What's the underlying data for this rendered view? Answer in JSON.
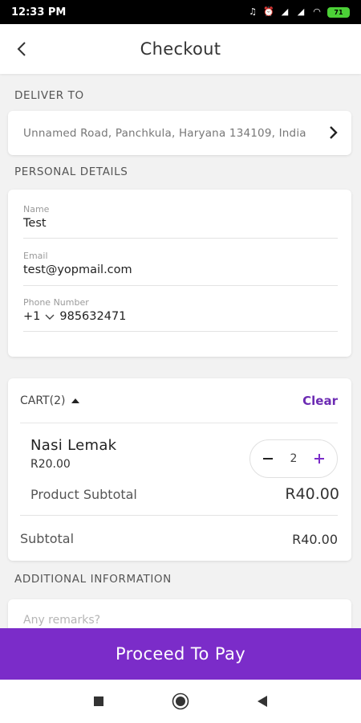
{
  "status_bar": {
    "time": "12:33 PM",
    "battery": "71"
  },
  "header": {
    "title": "Checkout"
  },
  "deliver_to": {
    "label": "DELIVER TO",
    "address": "Unnamed Road, Panchkula, Haryana 134109, India"
  },
  "personal_details": {
    "label": "PERSONAL DETAILS",
    "name_label": "Name",
    "name_value": "Test",
    "email_label": "Email",
    "email_value": "test@yopmail.com",
    "phone_label": "Phone Number",
    "phone_code": "+1",
    "phone_value": "985632471"
  },
  "cart": {
    "title": "CART(2)",
    "clear_label": "Clear",
    "item": {
      "name": "Nasi Lemak",
      "price": "R20.00",
      "quantity": "2"
    },
    "product_subtotal_label": "Product Subtotal",
    "product_subtotal_value": "R40.00",
    "subtotal_label": "Subtotal",
    "subtotal_value": "R40.00"
  },
  "additional_info": {
    "label": "ADDITIONAL INFORMATION",
    "remarks_placeholder": "Any remarks?"
  },
  "pay_button": {
    "label": "Proceed To Pay"
  },
  "colors": {
    "accent": "#7b2cc9",
    "accent_text": "#6c2bb3"
  },
  "icons": {
    "back": "back-arrow-icon",
    "address_chevron": "chevron-right-icon",
    "phone_dropdown": "chevron-down-icon",
    "cart_toggle": "caret-up-icon",
    "qty_minus": "minus-icon",
    "qty_plus": "plus-icon",
    "nav_recent": "square-icon",
    "nav_home": "circle-icon",
    "nav_back": "triangle-left-icon"
  }
}
